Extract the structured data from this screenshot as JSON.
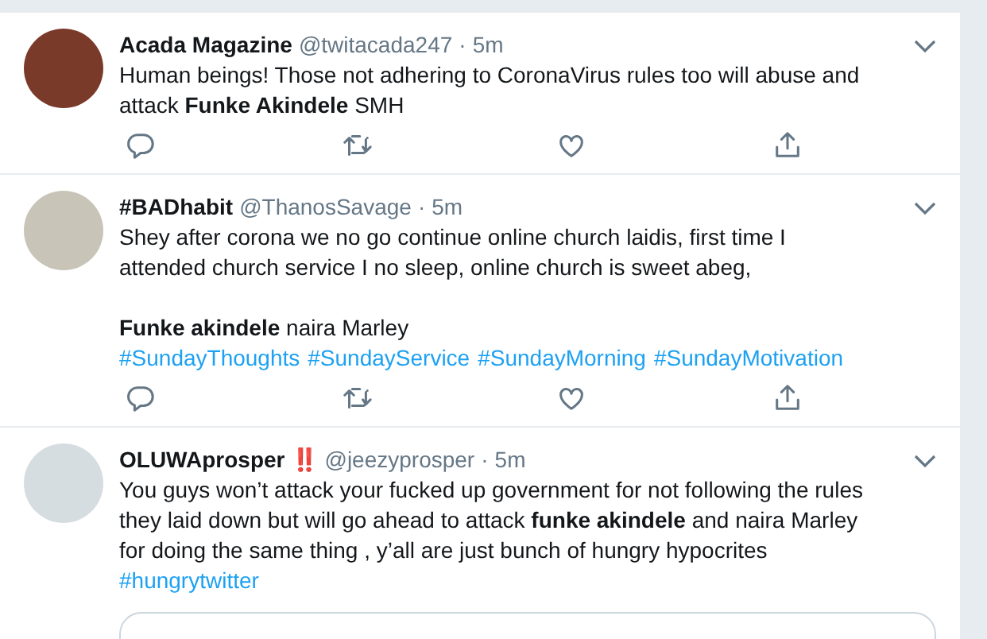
{
  "tweets": [
    {
      "name": "Acada Magazine",
      "handle": "@twitacada247",
      "dot": "·",
      "time": "5m",
      "body": [
        {
          "kind": "text",
          "text": "Human beings! Those not adhering to CoronaVirus rules too will abuse and attack **Funke Akindele** SMH"
        }
      ],
      "quoted": false
    },
    {
      "name": "#BADhabit",
      "handle": "@ThanosSavage",
      "dot": "·",
      "time": "5m",
      "body": [
        {
          "kind": "text",
          "text": "Shey after corona we no go continue online church laidis, first time I attended church service I no sleep, online church is sweet abeg,"
        },
        {
          "kind": "gap"
        },
        {
          "kind": "text",
          "text": "**Funke akindele** naira Marley"
        },
        {
          "kind": "hashtags",
          "tags": [
            "#SundayThoughts",
            "#SundayService",
            "#SundayMorning",
            "#SundayMotivation"
          ]
        }
      ],
      "quoted": false
    },
    {
      "name": "OLUWAprosper",
      "badge": "‼️",
      "handle": "@jeezyprosper",
      "dot": "·",
      "time": "5m",
      "body": [
        {
          "kind": "text",
          "text": "You guys won’t attack your fucked up government for not following the rules they laid down but will go ahead to attack **funke akindele** and naira Marley for doing the same thing , y’all are just bunch of hungry hypocrites"
        },
        {
          "kind": "hashtags",
          "tags": [
            "#hungrytwitter"
          ]
        }
      ],
      "quoted": true
    }
  ]
}
